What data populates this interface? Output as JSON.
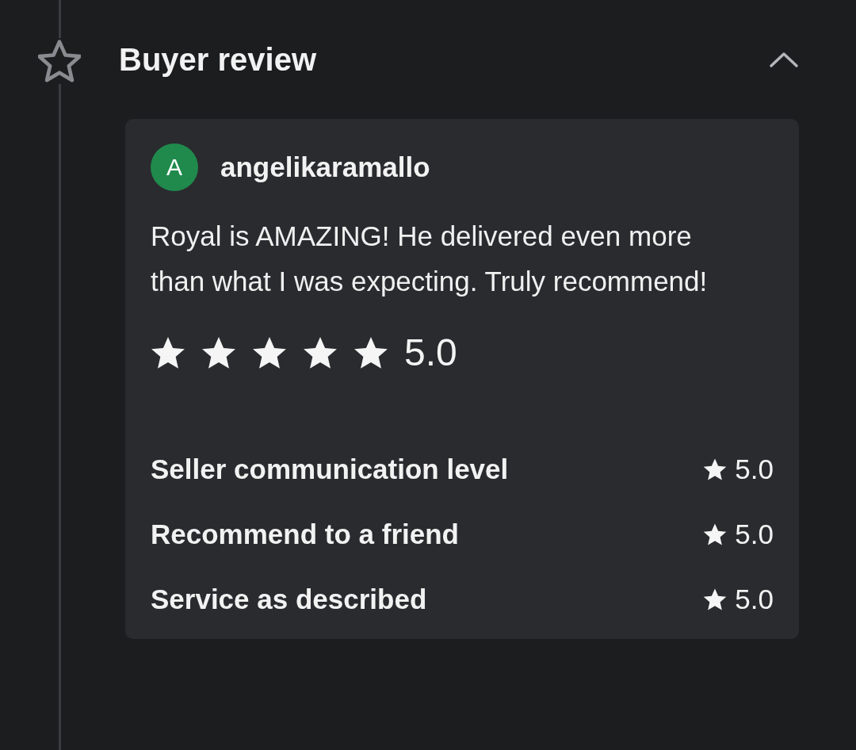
{
  "section": {
    "title": "Buyer review",
    "expanded": true
  },
  "review": {
    "avatar_letter": "A",
    "username": "angelikaramallo",
    "text": "Royal is AMAZING! He delivered even more than what I was expecting. Truly recommend!",
    "stars": 5,
    "score": "5.0",
    "ratings": [
      {
        "label": "Seller communication level",
        "value": "5.0"
      },
      {
        "label": "Recommend to a friend",
        "value": "5.0"
      },
      {
        "label": "Service as described",
        "value": "5.0"
      }
    ]
  }
}
